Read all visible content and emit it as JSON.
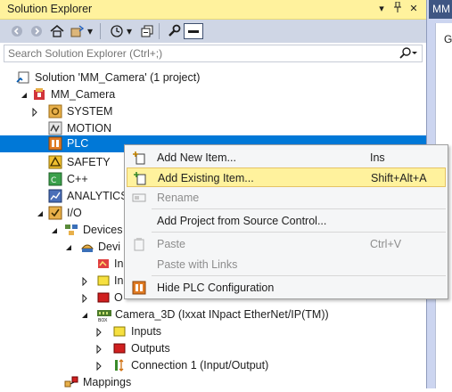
{
  "window": {
    "title": "Solution Explorer",
    "pin_glyph": "▾ ⊥ ✕",
    "right_panel_title": "MM",
    "right_panel_glyph": "G"
  },
  "search": {
    "placeholder": "Search Solution Explorer (Ctrl+;)"
  },
  "colors": {
    "title_bar": "#fff29d",
    "selection": "#0078d7",
    "menu_highlight": "#fff29d",
    "toolbar": "#cfd6e5"
  },
  "tree": {
    "solution": "Solution 'MM_Camera' (1 project)",
    "project": "MM_Camera",
    "system": "SYSTEM",
    "motion": "MOTION",
    "plc": "PLC",
    "safety": "SAFETY",
    "cpp": "C++",
    "analytics": "ANALYTICS",
    "io": "I/O",
    "devices": "Devices",
    "device1_partial": "Devi",
    "dev_child1_partial": "In",
    "dev_child2_partial": "In",
    "dev_child3_partial": "O",
    "camera": "Camera_3D (Ixxat INpact EtherNet/IP(TM))",
    "inputs": "Inputs",
    "outputs": "Outputs",
    "connection": "Connection 1 (Input/Output)",
    "mappings": "Mappings"
  },
  "menu": {
    "add_new_item": "Add New Item...",
    "add_new_item_key": "Ins",
    "add_existing_item": "Add Existing Item...",
    "add_existing_item_key": "Shift+Alt+A",
    "rename": "Rename",
    "add_from_source_control": "Add Project from Source Control...",
    "paste": "Paste",
    "paste_key": "Ctrl+V",
    "paste_with_links": "Paste with Links",
    "hide_plc": "Hide PLC Configuration"
  }
}
